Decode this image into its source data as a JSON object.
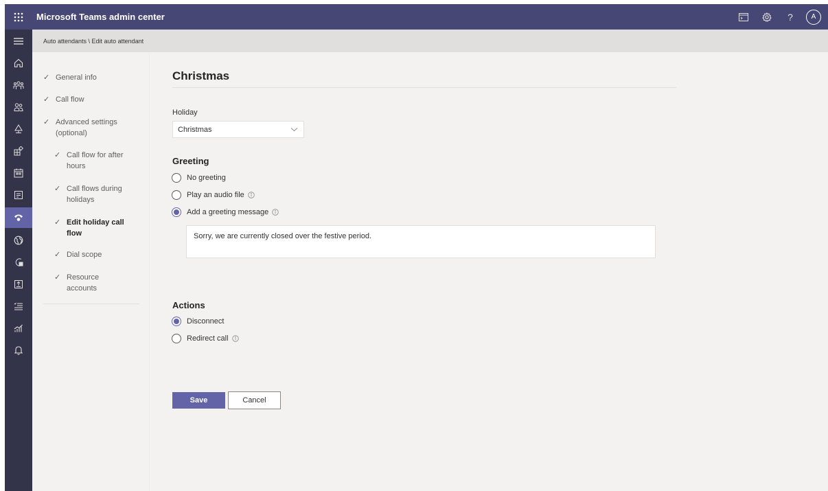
{
  "header": {
    "title": "Microsoft Teams admin center",
    "avatar_initial": "A",
    "help_label": "?"
  },
  "breadcrumb": "Auto attendants \\ Edit auto attendant",
  "steps": [
    {
      "label": "General info"
    },
    {
      "label": "Call flow"
    },
    {
      "label": "Advanced settings (optional)"
    },
    {
      "label": "Call flow for after hours"
    },
    {
      "label": "Call flows during holidays"
    },
    {
      "label": "Edit holiday call flow"
    },
    {
      "label": "Dial scope"
    },
    {
      "label": "Resource accounts"
    }
  ],
  "page": {
    "title": "Christmas",
    "holiday_label": "Holiday",
    "holiday_value": "Christmas",
    "greeting_heading": "Greeting",
    "greeting_options": [
      {
        "label": "No greeting",
        "selected": false
      },
      {
        "label": "Play an audio file",
        "selected": false
      },
      {
        "label": "Add a greeting message",
        "selected": true
      }
    ],
    "greeting_message": "Sorry, we are currently closed over the festive period.",
    "actions_heading": "Actions",
    "action_options": [
      {
        "label": "Disconnect",
        "selected": true
      },
      {
        "label": "Redirect call",
        "selected": false
      }
    ],
    "save_label": "Save",
    "cancel_label": "Cancel"
  },
  "colors": {
    "brand": "#6264a7",
    "topbar": "#464775",
    "rail": "#33344a"
  }
}
